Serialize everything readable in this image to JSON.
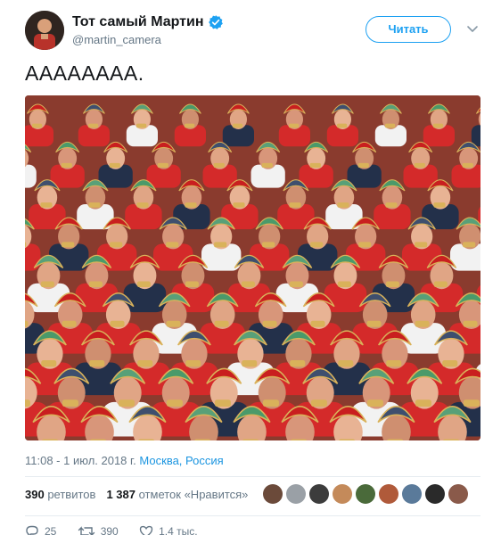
{
  "user": {
    "display_name": "Тот самый Мартин",
    "handle": "@martin_camera",
    "verified": true
  },
  "follow_button": {
    "label": "Читать"
  },
  "tweet": {
    "text": "АААААААА."
  },
  "meta": {
    "time": "11:08 - 1 июл. 2018 г.",
    "place": "Москва, Россия"
  },
  "stats": {
    "retweets_count": "390",
    "retweets_label": "ретвитов",
    "likes_count": "1 387",
    "likes_label": "отметок «Нравится»"
  },
  "likers": [
    {
      "color": "#6b4a3a"
    },
    {
      "color": "#9aa0a6"
    },
    {
      "color": "#3c3c3c"
    },
    {
      "color": "#c48a5a"
    },
    {
      "color": "#4a6a3a"
    },
    {
      "color": "#b05a3a"
    },
    {
      "color": "#5a7a9a"
    },
    {
      "color": "#2a2a2a"
    },
    {
      "color": "#8a5a4a"
    }
  ],
  "actions": {
    "reply_count": "25",
    "retweet_count": "390",
    "like_count": "1,4 тыс."
  },
  "colors": {
    "accent": "#1da1f2",
    "secondary_text": "#657786",
    "link": "#1b95e0"
  }
}
